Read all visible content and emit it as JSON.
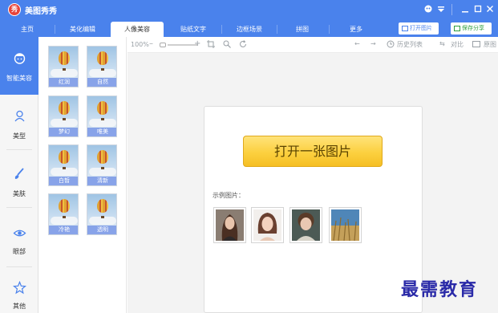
{
  "app": {
    "title": "美图秀秀",
    "logo_glyph": "秀"
  },
  "window_controls": [
    "skin-icon",
    "menu-icon",
    "minimize-icon",
    "maximize-icon",
    "close-icon"
  ],
  "tabs": [
    {
      "label": "主页",
      "active": false
    },
    {
      "label": "美化编辑",
      "active": false
    },
    {
      "label": "人像美容",
      "active": true
    },
    {
      "label": "贴纸文字",
      "active": false
    },
    {
      "label": "边框场景",
      "active": false
    },
    {
      "label": "拼图",
      "active": false
    },
    {
      "label": "更多",
      "active": false
    }
  ],
  "header_buttons": {
    "open": "打开图片",
    "save": "保存分享"
  },
  "sidebar": [
    {
      "label": "智能美容",
      "icon": "smart-beauty-icon",
      "active": true
    },
    {
      "label": "美型",
      "icon": "face-shape-icon",
      "active": false
    },
    {
      "label": "美肤",
      "icon": "skin-brush-icon",
      "active": false
    },
    {
      "label": "眼部",
      "icon": "eye-icon",
      "active": false
    },
    {
      "label": "其他",
      "icon": "star-icon",
      "active": false
    }
  ],
  "effects": [
    "红润",
    "自然",
    "梦幻",
    "唯美",
    "白皙",
    "清新",
    "冷艳",
    "透明"
  ],
  "toolbar": {
    "zoom": "100%",
    "history": "历史列表",
    "compare": "对比",
    "original": "原图"
  },
  "main": {
    "open_button": "打开一张图片",
    "sample_label": "示例图片："
  },
  "samples": [
    "sample-portrait-woman",
    "sample-portrait-girl",
    "sample-portrait-child",
    "sample-landscape-grass"
  ],
  "watermark": "最需教育",
  "colors": {
    "brand_blue": "#4a82ec",
    "button_yellow": "#fcd03f",
    "save_green": "#2e9e3d"
  }
}
